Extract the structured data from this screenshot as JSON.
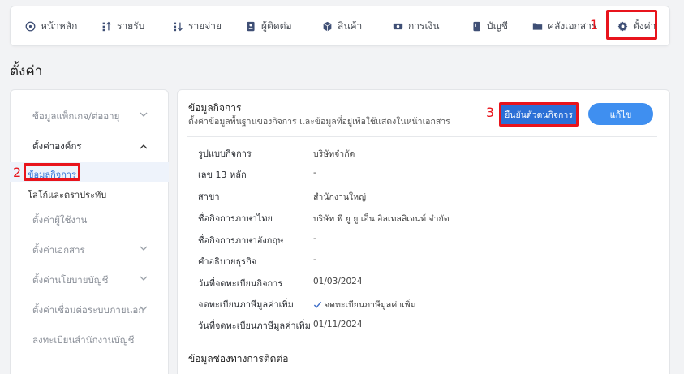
{
  "nav": {
    "items": [
      {
        "label": "หน้าหลัก",
        "icon": "dashboard-icon"
      },
      {
        "label": "รายรับ",
        "icon": "income-icon"
      },
      {
        "label": "รายจ่าย",
        "icon": "expense-icon"
      },
      {
        "label": "ผู้ติดต่อ",
        "icon": "contacts-icon"
      },
      {
        "label": "สินค้า",
        "icon": "box-icon"
      },
      {
        "label": "การเงิน",
        "icon": "money-icon"
      },
      {
        "label": "บัญชี",
        "icon": "ledger-icon"
      },
      {
        "label": "คลังเอกสาร",
        "icon": "folder-icon"
      },
      {
        "label": "ตั้งค่า",
        "icon": "gear-icon"
      }
    ]
  },
  "annotations": {
    "n1": "1",
    "n2": "2",
    "n3": "3"
  },
  "page_title": "ตั้งค่า",
  "sidebar": {
    "package": "ข้อมูลแพ็กเกจ/ต่ออายุ",
    "org": "ตั้งค่าองค์กร",
    "org_sub": {
      "business_info": "ข้อมูลกิจการ",
      "logo": "โลโก้และตราประทับ"
    },
    "users": "ตั้งค่าผู้ใช้งาน",
    "documents": "ตั้งค่าเอกสาร",
    "accounting_policy": "ตั้งค่านโยบายบัญชี",
    "integrations": "ตั้งค่าเชื่อมต่อระบบภายนอก",
    "accounting_office": "ลงทะเบียนสำนักงานบัญชี"
  },
  "main": {
    "section_title": "ข้อมูลกิจการ",
    "section_desc": "ตั้งค่าข้อมูลพื้นฐานของกิจการ และข้อมูลที่อยู่เพื่อใช้แสดงในหน้าเอกสาร",
    "verify_button": "ยืนยันตัวตนกิจการ",
    "edit_button": "แก้ไข",
    "rows": [
      {
        "label": "รูปแบบกิจการ",
        "value": "บริษัทจำกัด"
      },
      {
        "label": "เลข 13 หลัก",
        "value": "-"
      },
      {
        "label": "สาขา",
        "value": "สำนักงานใหญ่"
      },
      {
        "label": "ชื่อกิจการภาษาไทย",
        "value": "บริษัท พี ยู ยู เอ็น อิลเทลลิเจนท์ จำกัด"
      },
      {
        "label": "ชื่อกิจการภาษาอังกฤษ",
        "value": "-"
      },
      {
        "label": "คำอธิบายธุรกิจ",
        "value": "-"
      },
      {
        "label": "วันที่จดทะเบียนกิจการ",
        "value": "01/03/2024"
      },
      {
        "label": "จดทะเบียนภาษีมูลค่าเพิ่ม",
        "value": "จดทะเบียนภาษีมูลค่าเพิ่ม"
      },
      {
        "label": "วันที่จดทะเบียนภาษีมูลค่าเพิ่ม",
        "value": "01/11/2024"
      }
    ],
    "contact_title": "ข้อมูลช่องทางการติดต่อ"
  }
}
